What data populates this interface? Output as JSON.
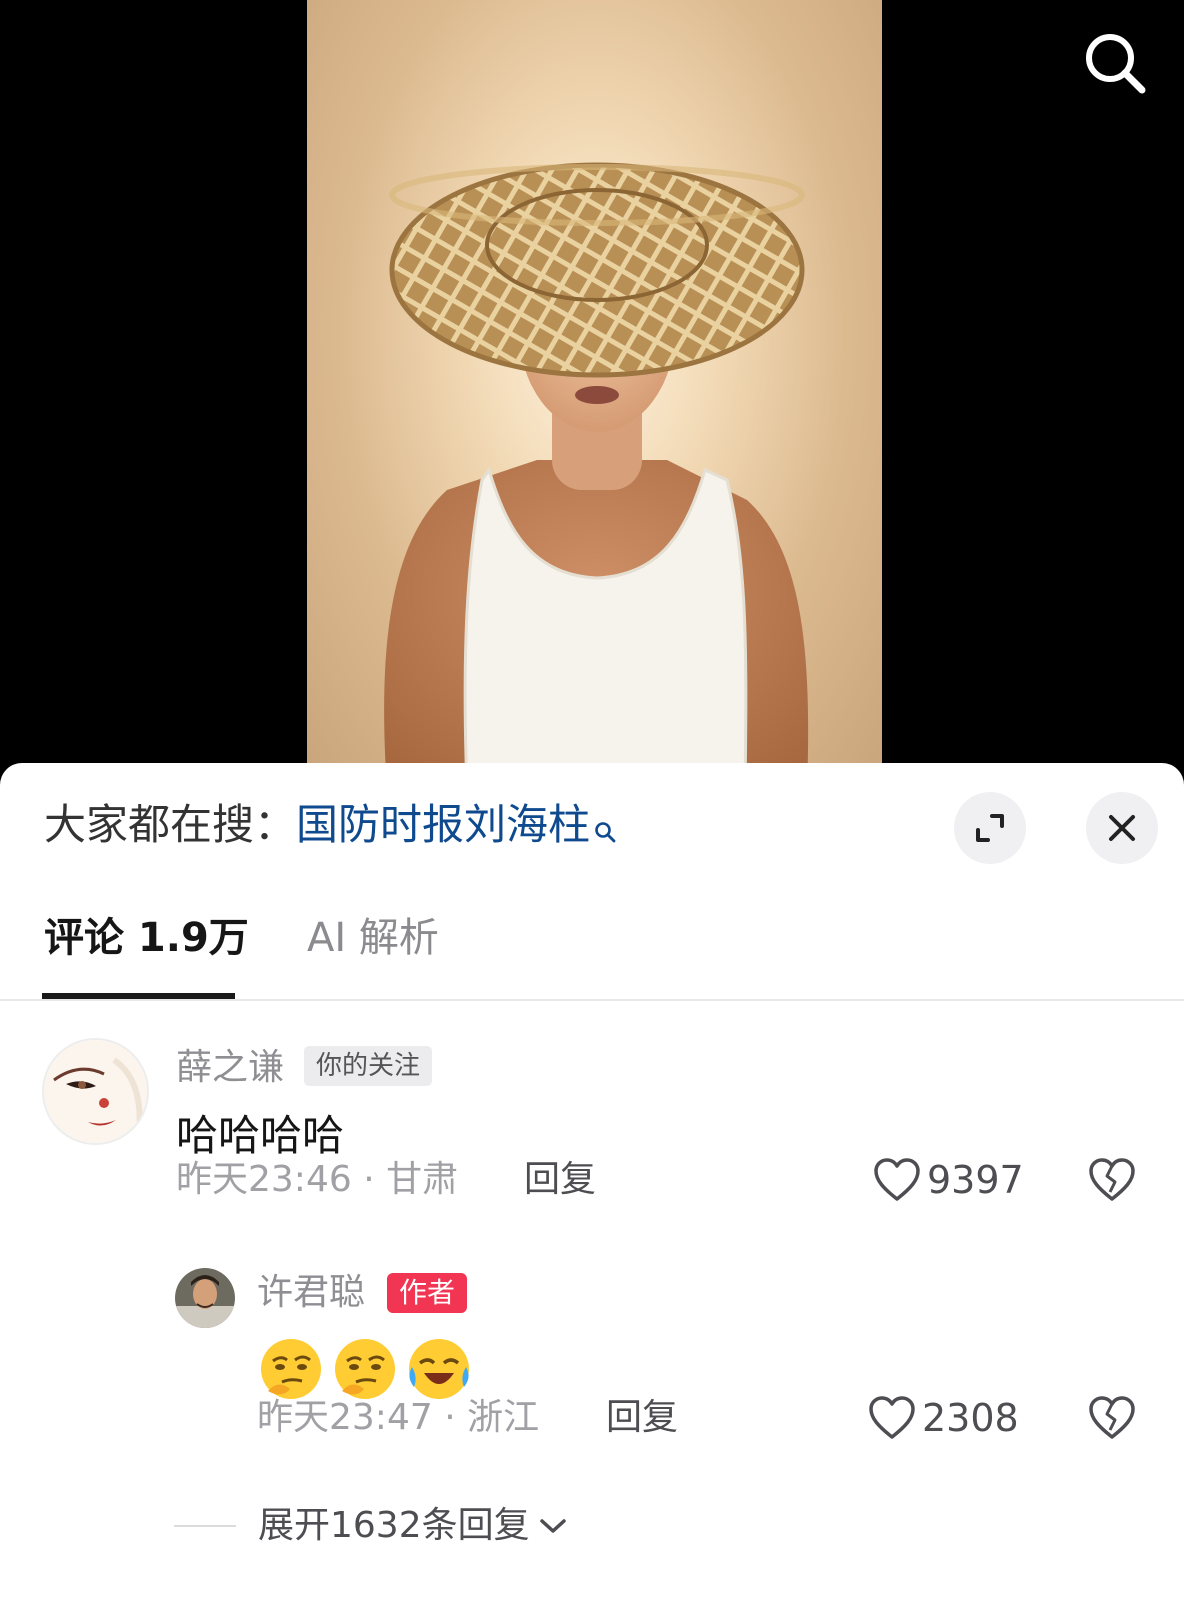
{
  "video": {
    "search_icon": "search-icon"
  },
  "hot_search": {
    "prefix": "大家都在搜：",
    "keyword": "国防时报刘海柱"
  },
  "tabs": [
    {
      "label": "评论 1.9万",
      "active": true
    },
    {
      "label": "AI 解析",
      "active": false
    }
  ],
  "comment": {
    "username": "薛之谦",
    "badge": "你的关注",
    "text": "哈哈哈哈",
    "time": "昨天23:46 · 甘肃",
    "reply_label": "回复",
    "likes": "9397"
  },
  "reply": {
    "username": "许君聪",
    "badge": "作者",
    "emojis": [
      "thinking-smug-emoji",
      "thinking-smug-emoji",
      "laugh-cry-emoji"
    ],
    "time": "昨天23:47 · 浙江",
    "reply_label": "回复",
    "likes": "2308"
  },
  "expand_replies": {
    "label": "展开1632条回复"
  },
  "colors": {
    "keyword_blue": "#0f4a8f",
    "author_badge": "#f23553",
    "follow_badge_bg": "#ececef"
  }
}
